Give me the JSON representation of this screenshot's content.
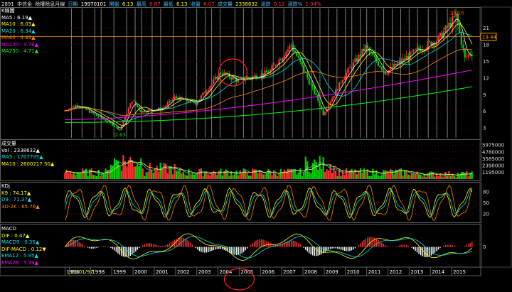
{
  "header": {
    "stock_code": "2891",
    "stock_name": "中信金",
    "mode": "除權除息月線",
    "date_label": "日期",
    "date": "19970101",
    "open_label": "開盤",
    "open": "6.13",
    "high_label": "最高",
    "high": "6.87",
    "low_label": "最低",
    "low": "6.13",
    "close_label": "收盤",
    "close": "6.07",
    "volume_label": "成交量",
    "volume": "2338632",
    "change_label": "漲跌",
    "change": "0.12",
    "pct_label": "漲跌%",
    "pct": "1.94%"
  },
  "colors": {
    "up": "#ff3030",
    "down": "#00d000",
    "ma5": "#ffffff",
    "ma10": "#ffff00",
    "ma20": "#00e0e0",
    "ma60": "#ff8800",
    "ma120": "#ff00ff",
    "ma250": "#00ff00",
    "grid": "#800000",
    "annot": "#ff2020"
  },
  "price_panel": {
    "title": "K線圖",
    "legend": [
      {
        "text": "MA5 : 6.19▲",
        "color": "#ffffff"
      },
      {
        "text": "MA10 : 6.03▲",
        "color": "#ffff00"
      },
      {
        "text": "MA20 : 6.34▲",
        "color": "#00e0e0"
      },
      {
        "text": "MA60 : 4.89▲",
        "color": "#ff8800"
      },
      {
        "text": "MA120 : 4.76▲",
        "color": "#ff00ff"
      },
      {
        "text": "MA250 : 4.71▲",
        "color": "#00ff00"
      }
    ],
    "high_marker": "23.16",
    "low_marker": "2.63",
    "current_price_tag": "19.44",
    "y_ticks": [
      "21",
      "18",
      "15",
      "12",
      "9",
      "6",
      "3"
    ]
  },
  "volume_panel": {
    "title": "成交量",
    "legend": [
      {
        "text": "Vol : 2338632▲",
        "color": "#ffffff"
      },
      {
        "text": "MA5 : 1707795▲",
        "color": "#00e0e0"
      },
      {
        "text": "MA10 : 2600217.50▲",
        "color": "#ffff00"
      }
    ],
    "y_ticks": [
      "5975000",
      "4780000",
      "3585000",
      "2390000",
      "1195000"
    ]
  },
  "kdj_panel": {
    "title": "KDj",
    "legend": [
      {
        "text": "K9 : 74.17▲",
        "color": "#ffff00"
      },
      {
        "text": "D9 : 71.37▲",
        "color": "#00e0e0"
      },
      {
        "text": "3D-2K : 65.76▲",
        "color": "#ff8800"
      }
    ],
    "y_ticks": [
      "80",
      "50",
      "20"
    ]
  },
  "macd_panel": {
    "title": "MACD",
    "legend": [
      {
        "text": "DIF : 0.47▲",
        "color": "#ffff00"
      },
      {
        "text": "MACD9 : 0.35▲",
        "color": "#00e0e0"
      },
      {
        "text": "DIF-MACD : 0.12▼",
        "color": "#ffff00"
      },
      {
        "text": "EMA12 : 5.95▲",
        "color": "#00e0e0"
      },
      {
        "text": "EMA26 : 5.39▲",
        "color": "#ff00ff"
      }
    ],
    "y_ticks": [
      "0"
    ]
  },
  "x_axis": {
    "labels": [
      "1996",
      "01/01/97",
      "1998",
      "1999",
      "2000",
      "2001",
      "2002",
      "2003",
      "2004",
      "2005",
      "2006",
      "2007",
      "2008",
      "2009",
      "2010",
      "2011",
      "2012",
      "2013",
      "2014",
      "2015"
    ],
    "highlighted": "01/01"
  },
  "chart_data": {
    "type": "candlestick",
    "interval": "monthly",
    "x_range": [
      "1996-10",
      "2015-12"
    ],
    "price_ylim": [
      2,
      24
    ],
    "series_keypoints": [
      {
        "date": "1996-10",
        "close": 6.0
      },
      {
        "date": "1997-06",
        "close": 7.2
      },
      {
        "date": "1998-12",
        "close": 4.0
      },
      {
        "date": "1999-06",
        "close": 2.63
      },
      {
        "date": "2000-01",
        "close": 8.0
      },
      {
        "date": "2000-06",
        "close": 6.0
      },
      {
        "date": "2001-06",
        "close": 6.5
      },
      {
        "date": "2002-01",
        "close": 8.5
      },
      {
        "date": "2003-01",
        "close": 7.5
      },
      {
        "date": "2004-03",
        "close": 13.0
      },
      {
        "date": "2005-01",
        "close": 11.5
      },
      {
        "date": "2006-06",
        "close": 13.0
      },
      {
        "date": "2007-07",
        "close": 18.0
      },
      {
        "date": "2008-10",
        "close": 8.0
      },
      {
        "date": "2009-01",
        "close": 5.5
      },
      {
        "date": "2009-12",
        "close": 12.0
      },
      {
        "date": "2011-01",
        "close": 17.5
      },
      {
        "date": "2011-12",
        "close": 13.0
      },
      {
        "date": "2013-06",
        "close": 17.0
      },
      {
        "date": "2014-06",
        "close": 19.0
      },
      {
        "date": "2015-04",
        "close": 23.16
      },
      {
        "date": "2015-09",
        "close": 15.5
      },
      {
        "date": "2015-12",
        "close": 16.5
      }
    ],
    "volume_ylim": [
      0,
      6500000
    ],
    "kdj_ylim": [
      0,
      100
    ],
    "grid": true
  }
}
